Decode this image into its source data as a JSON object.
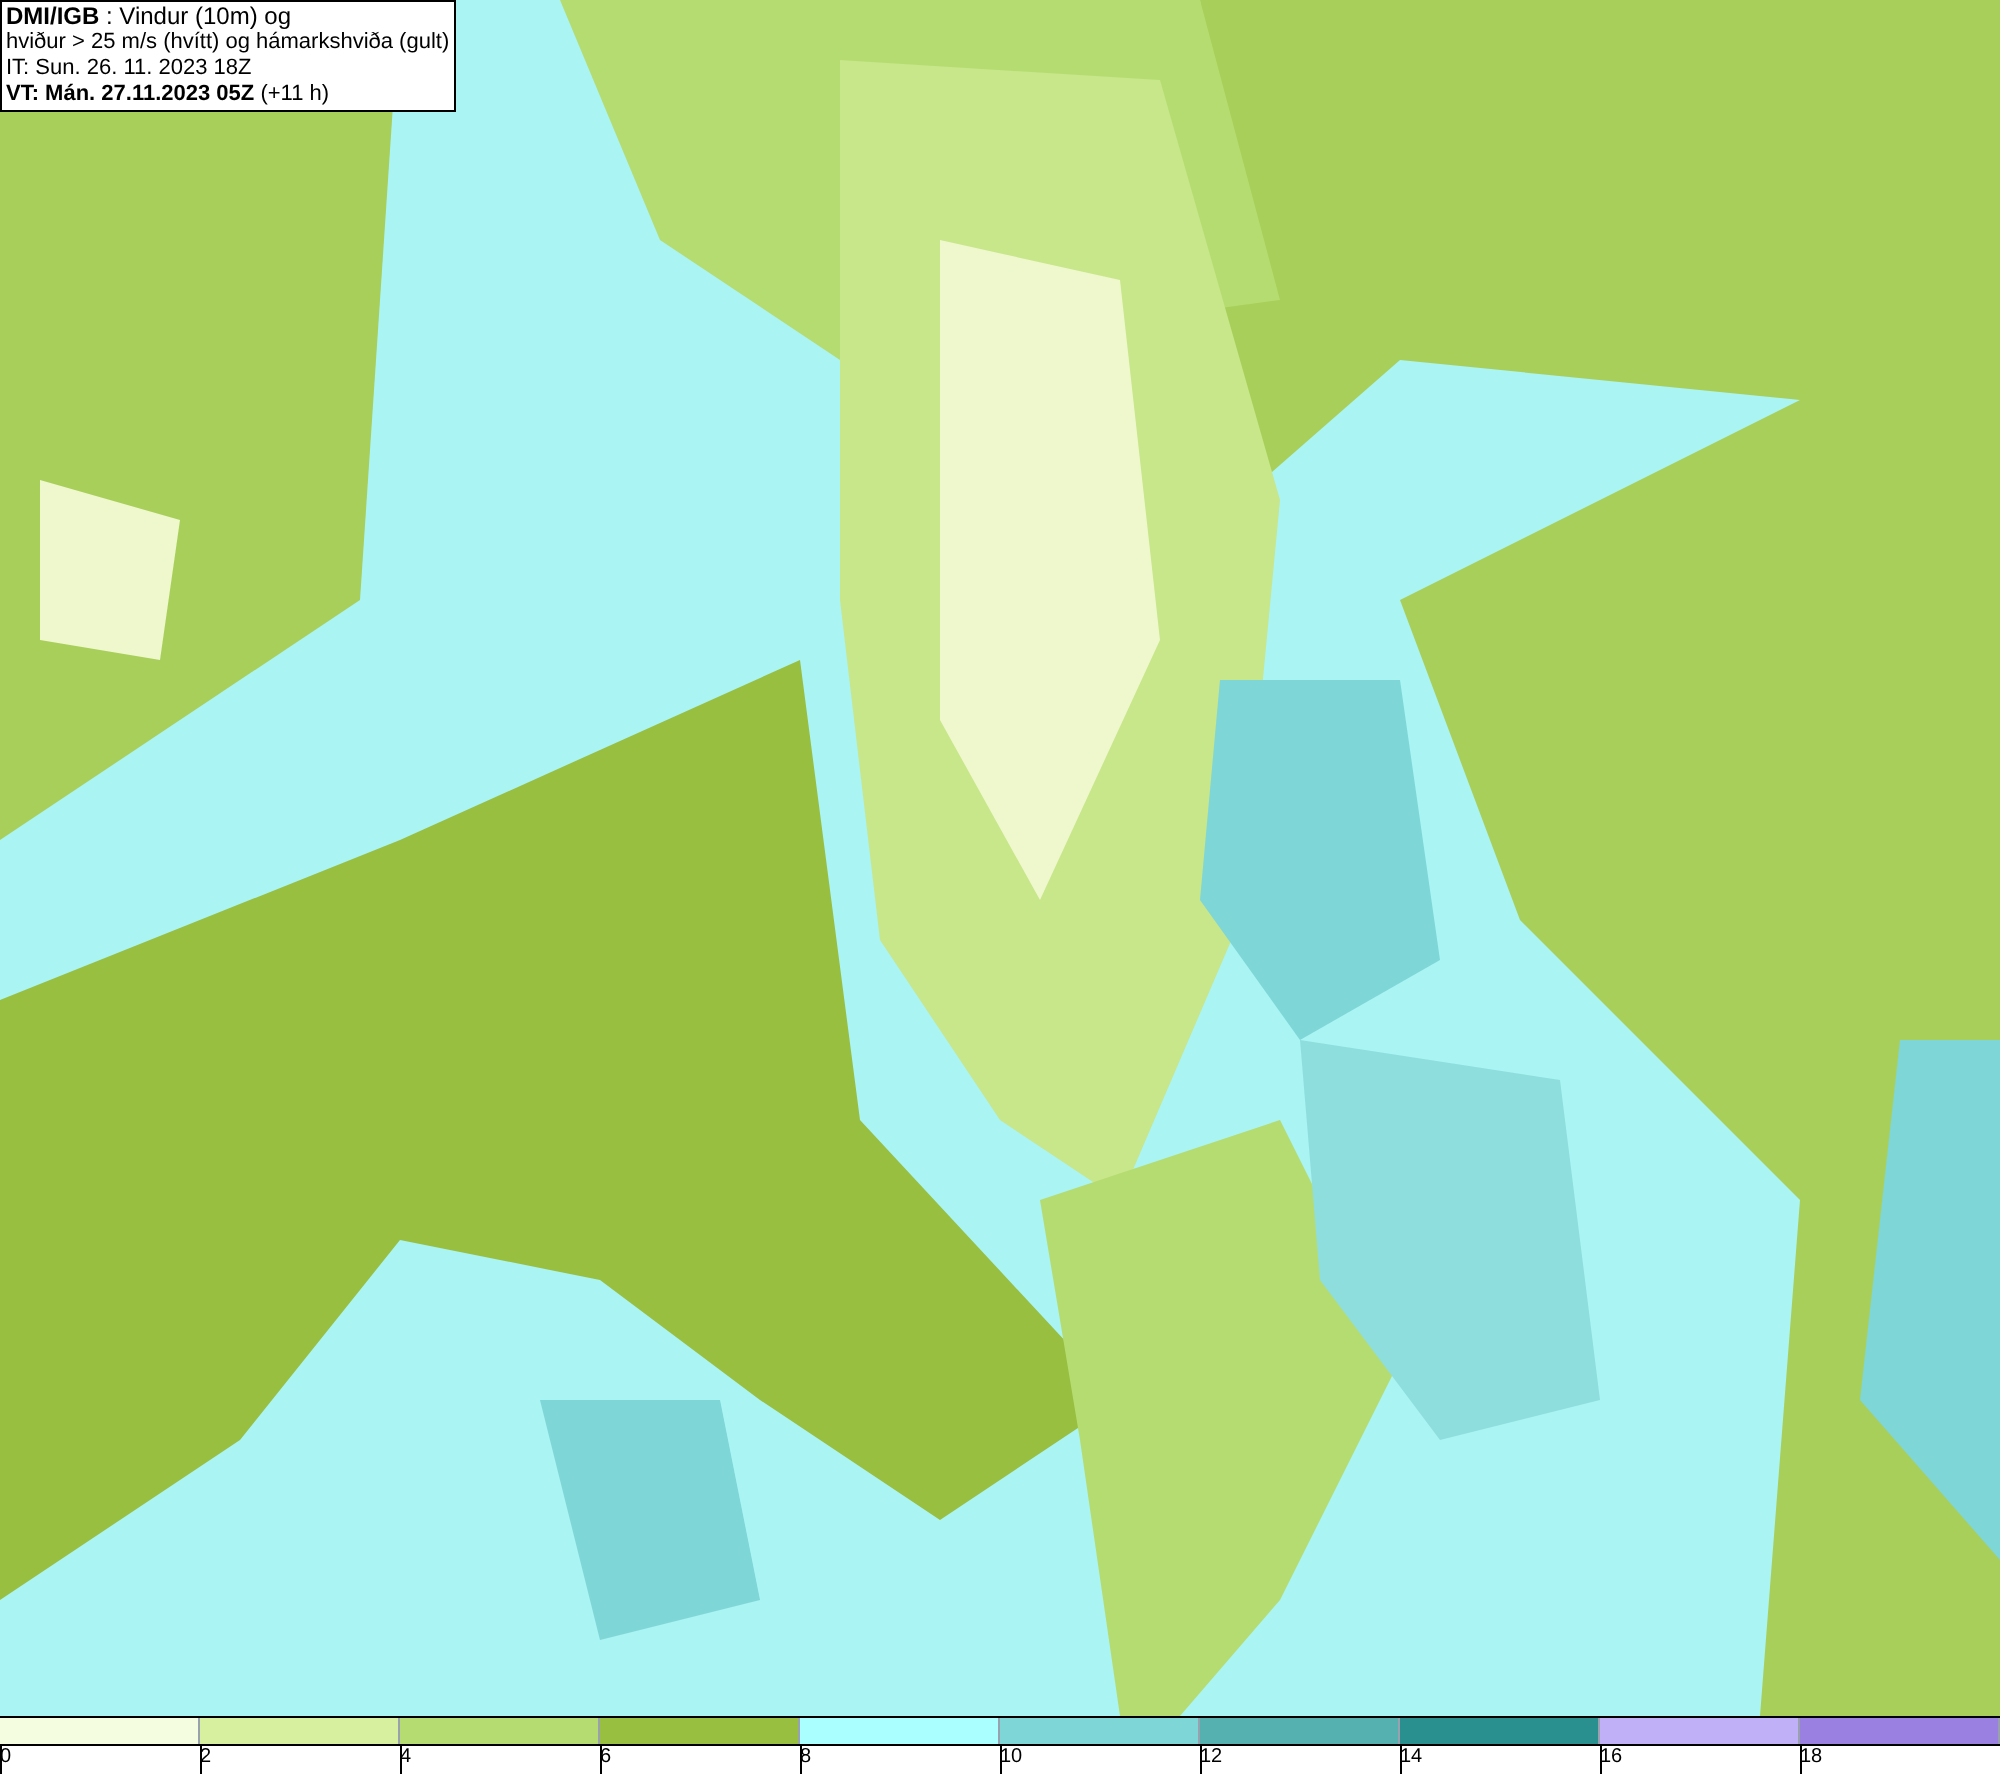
{
  "info_box": {
    "lines": [
      "**DMI/IGB** : Vindur (10m) og",
      "hviður > 25 m/s (hvítt) og hámarkshviða (gult)",
      "IT: Sun. 26. 11. 2023 18Z",
      "**VT: Mán. 27.11.2023 05Z** (+11 h)"
    ]
  },
  "legend": {
    "segments": [
      {
        "color": "#f5fde0",
        "label": "0"
      },
      {
        "color": "#d6f0a0",
        "label": "2"
      },
      {
        "color": "#b5dc70",
        "label": "4"
      },
      {
        "color": "#98bf40",
        "label": "6"
      },
      {
        "color": "#aaffff",
        "label": "8"
      },
      {
        "color": "#7fd6d6",
        "label": "10"
      },
      {
        "color": "#55b0b0",
        "label": "12"
      },
      {
        "color": "#2a8f8f",
        "label": "14"
      },
      {
        "color": "#c0b0f8",
        "label": "16"
      },
      {
        "color": "#9a80e0",
        "label": "18"
      }
    ]
  }
}
